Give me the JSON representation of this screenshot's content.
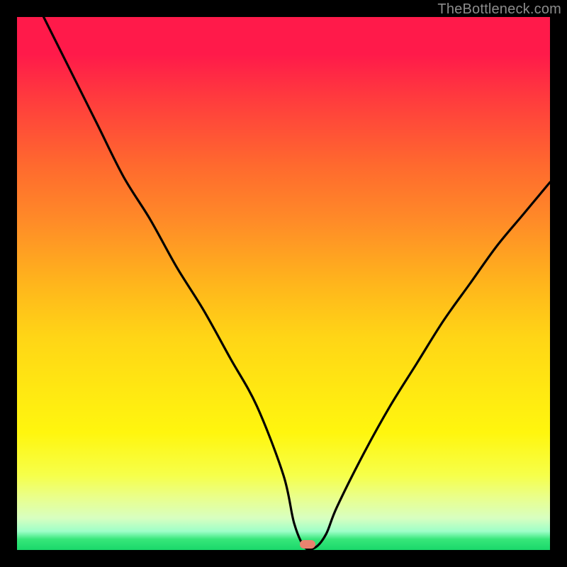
{
  "watermark": "TheBottleneck.com",
  "marker": {
    "x_pct": 54.5,
    "y_pct": 99.0,
    "color": "#e9836f"
  },
  "chart_data": {
    "type": "line",
    "title": "",
    "xlabel": "",
    "ylabel": "",
    "xlim": [
      0,
      100
    ],
    "ylim": [
      0,
      100
    ],
    "grid": false,
    "series": [
      {
        "name": "bottleneck-curve",
        "x": [
          5,
          10,
          15,
          20,
          25,
          30,
          35,
          40,
          45,
          50,
          52,
          54,
          56,
          58,
          60,
          65,
          70,
          75,
          80,
          85,
          90,
          95,
          100
        ],
        "y": [
          100,
          90,
          80,
          70,
          62,
          53,
          45,
          36,
          27,
          14,
          5,
          0.5,
          0.5,
          3,
          8,
          18,
          27,
          35,
          43,
          50,
          57,
          63,
          69
        ]
      }
    ],
    "annotations": [
      {
        "type": "marker",
        "x": 54.5,
        "y": 1.0,
        "label": "optimal-point"
      }
    ],
    "background_gradient": {
      "direction": "vertical",
      "stops": [
        {
          "pos": 0.0,
          "color": "#ff1a4a"
        },
        {
          "pos": 0.5,
          "color": "#ffb51c"
        },
        {
          "pos": 0.78,
          "color": "#fff60e"
        },
        {
          "pos": 0.94,
          "color": "#d8ffc0"
        },
        {
          "pos": 1.0,
          "color": "#1ad86a"
        }
      ]
    }
  }
}
